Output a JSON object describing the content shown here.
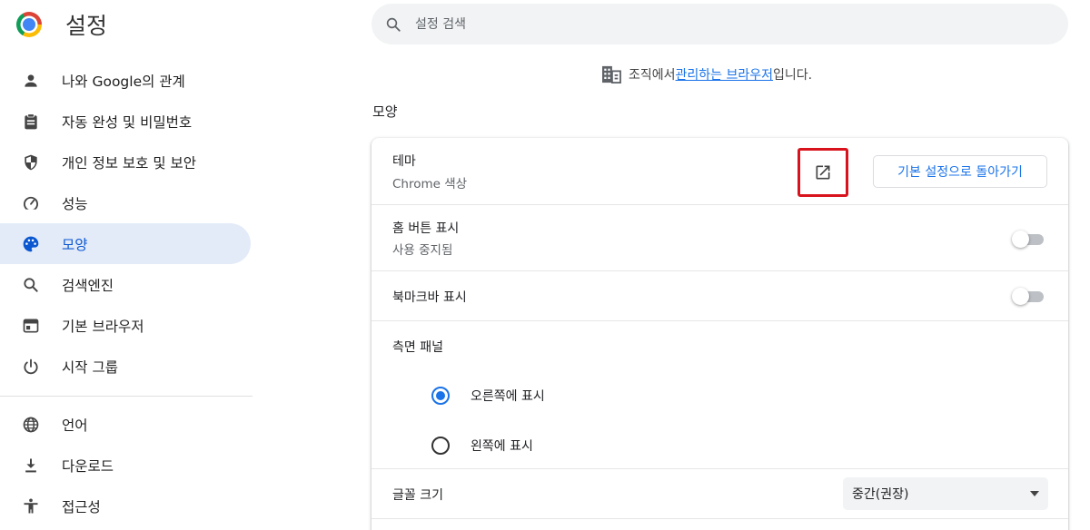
{
  "app": {
    "title": "설정"
  },
  "search": {
    "placeholder": "설정 검색"
  },
  "sidebar": {
    "items": [
      {
        "label": "나와 Google의 관계",
        "icon": "person-icon"
      },
      {
        "label": "자동 완성 및 비밀번호",
        "icon": "clipboard-icon"
      },
      {
        "label": "개인 정보 보호 및 보안",
        "icon": "shield-icon"
      },
      {
        "label": "성능",
        "icon": "speedometer-icon"
      },
      {
        "label": "모양",
        "icon": "palette-icon",
        "active": true
      },
      {
        "label": "검색엔진",
        "icon": "search-icon"
      },
      {
        "label": "기본 브라우저",
        "icon": "browser-icon"
      },
      {
        "label": "시작 그룹",
        "icon": "power-icon"
      },
      {
        "label": "언어",
        "icon": "globe-icon"
      },
      {
        "label": "다운로드",
        "icon": "download-icon"
      },
      {
        "label": "접근성",
        "icon": "accessibility-icon"
      }
    ]
  },
  "managed": {
    "prefix": "조직에서 ",
    "link": "관리하는 브라우저",
    "suffix": "입니다.",
    "icon": "building-icon"
  },
  "section": {
    "title": "모양"
  },
  "theme": {
    "label": "테마",
    "sub": "Chrome 색상",
    "reset_label": "기본 설정으로 돌아가기",
    "icon": "open-in-new-icon"
  },
  "home_button": {
    "label": "홈 버튼 표시",
    "sub": "사용 중지됨",
    "enabled": false
  },
  "bookmarks_bar": {
    "label": "북마크바 표시",
    "enabled": false
  },
  "side_panel": {
    "label": "측면 패널",
    "options": [
      {
        "label": "오른쪽에 표시",
        "selected": true
      },
      {
        "label": "왼쪽에 표시",
        "selected": false
      }
    ]
  },
  "font_size": {
    "label": "글꼴 크기",
    "value": "중간(권장)"
  },
  "colors": {
    "accent": "#1a73e8",
    "active_bg": "#e3ebf9",
    "highlight": "#d8131d"
  }
}
